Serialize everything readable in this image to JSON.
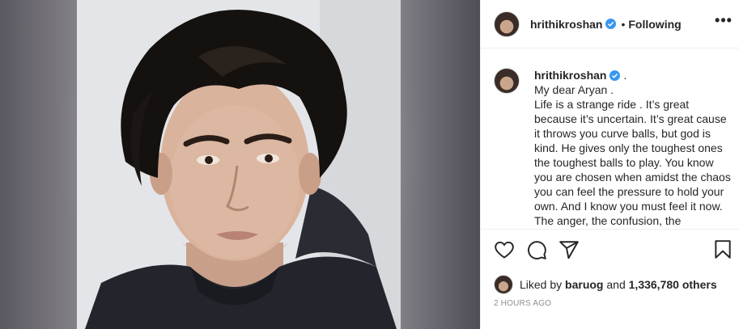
{
  "post": {
    "username": "hrithikroshan",
    "follow_status": "Following",
    "separator": "•",
    "more": "•••",
    "caption_username": "hrithikroshan",
    "caption_suffix": ".",
    "caption_text": "My dear Aryan .\nLife is a strange ride . It’s great because it’s uncertain. It’s great cause it throws you curve balls, but god is kind. He gives only the toughest ones the toughest balls to play. You know you are chosen when amidst the chaos you can feel the pressure to hold your own. And I know you must feel it now. The anger, the confusion, the helplessness. Aaah , the",
    "liked_by_prefix": "Liked by",
    "liked_by_user": "baruog",
    "liked_by_and": "and",
    "likes_count": "1,336,780 others",
    "timestamp": "2 HOURS AGO"
  },
  "icons": {
    "verified": "verified-badge-icon",
    "like": "heart-icon",
    "comment": "comment-icon",
    "share": "paper-plane-icon",
    "save": "bookmark-icon"
  },
  "colors": {
    "verified": "#3897f0",
    "text": "#262626",
    "muted": "#8e8e8e"
  }
}
